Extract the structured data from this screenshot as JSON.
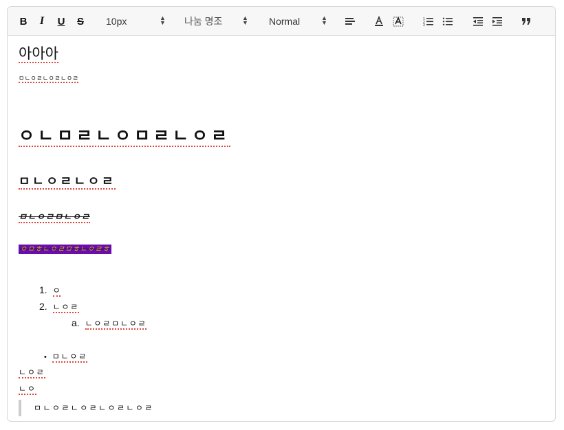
{
  "toolbar": {
    "font_size": "10px",
    "font_family": "나눔 명조",
    "heading": "Normal"
  },
  "content": {
    "line1": "아아아",
    "line2": "ㅁㄴㅇㄹㄴㅇㄹㄴㅇㄹ",
    "heading1": "ㅇㄴㅁㄹㄴㅇㅁㄹㄴㅇㄹ",
    "heading2": "ㅁㄴㅇㄹㄴㅇㄹ",
    "strike_line": "ㅁㄴㅇㄹㅁㄴㅇㄹ",
    "highlight_line": "ㅇㅁㅎㄴㅇㄹㅁㅎㄴㅇㄹㅎ",
    "ol": [
      {
        "marker": "1.",
        "text": "ㅇ"
      },
      {
        "marker": "2.",
        "text": "ㄴㅇㄹ"
      }
    ],
    "ol_sub": {
      "marker": "a.",
      "text": "ㄴㅇㄹㅁㄴㅇㄹ"
    },
    "ul_item": {
      "marker": "•",
      "text": "ㅁㄴㅇㄹ"
    },
    "line_after1": "ㄴㅇㄹ",
    "line_after2": "ㄴㅇ",
    "blockquote": "ㅁㄴㅇㄹㄴㅇㄹㄴㅇㄹㄴㅇㄹ"
  },
  "colors": {
    "highlight_bg": "#6a0dad",
    "highlight_fg": "#f2c200",
    "spell_underline": "#e0443c"
  }
}
